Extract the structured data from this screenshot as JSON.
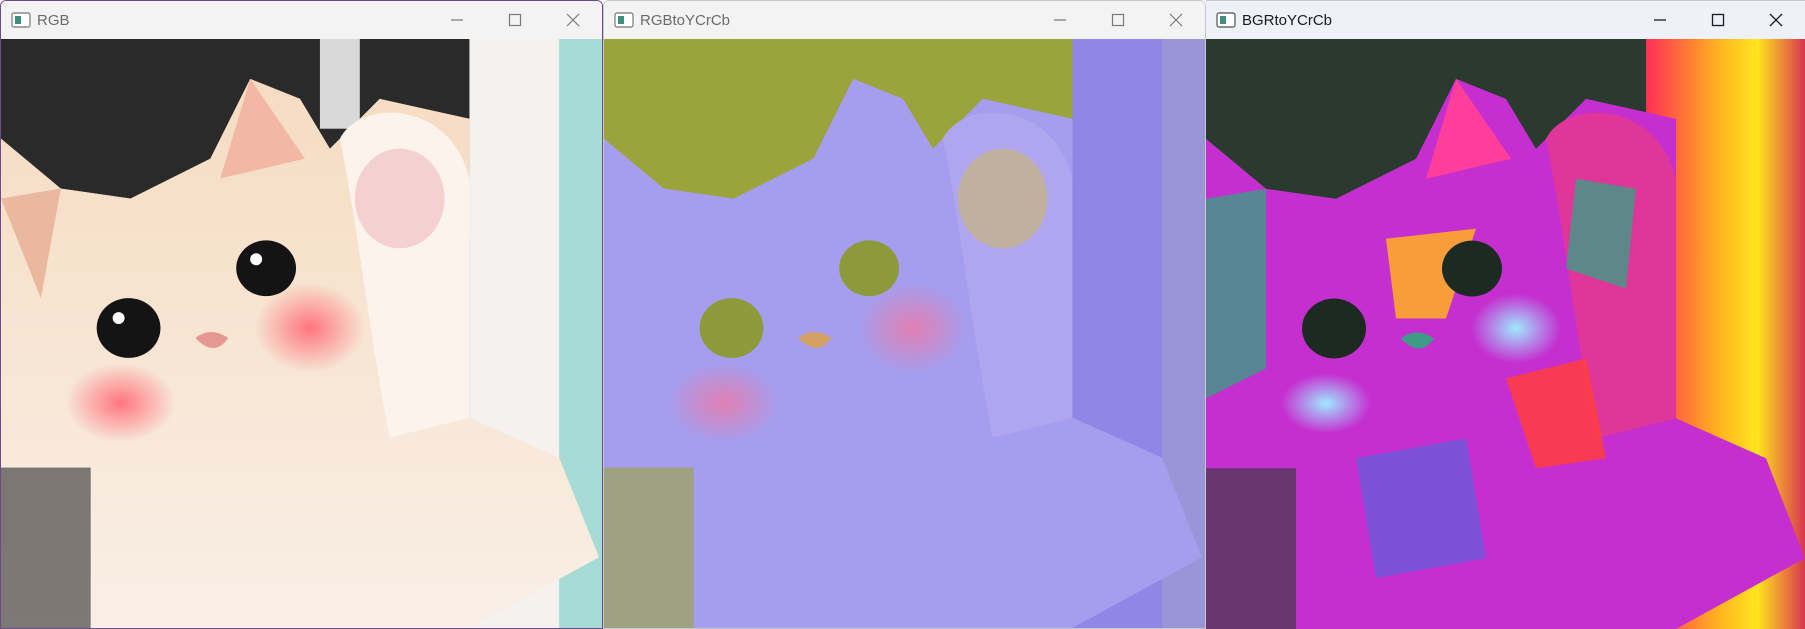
{
  "windows": [
    {
      "title": "RGB",
      "active": false,
      "icon": "opencv-window-icon",
      "controls": [
        "minimize-icon",
        "maximize-icon",
        "close-icon"
      ],
      "image": {
        "subject": "cat raising paw",
        "colors": {
          "background": "#2b2b2b",
          "fur": "#f1d6bd",
          "blush": "#ff7a86",
          "right_wall": "#a9dcd6"
        }
      }
    },
    {
      "title": "RGBtoYCrCb",
      "active": false,
      "icon": "opencv-window-icon",
      "controls": [
        "minimize-icon",
        "maximize-icon",
        "close-icon"
      ],
      "image": {
        "subject": "cat raising paw",
        "colors": {
          "background": "#9aa43a",
          "fur": "#a9a0ee",
          "blush": "#e47eb0",
          "wall": "#8f86e6"
        }
      }
    },
    {
      "title": "BGRtoYCrCb",
      "active": true,
      "icon": "opencv-window-icon",
      "controls": [
        "minimize-icon",
        "maximize-icon",
        "close-icon"
      ],
      "image": {
        "subject": "cat raising paw",
        "colors": {
          "background": "#2a3a2e",
          "fur": "#d12fd4",
          "highlight": "#ff3d6a",
          "bright": "#ffe51f",
          "teal": "#3d9c86"
        }
      }
    }
  ]
}
